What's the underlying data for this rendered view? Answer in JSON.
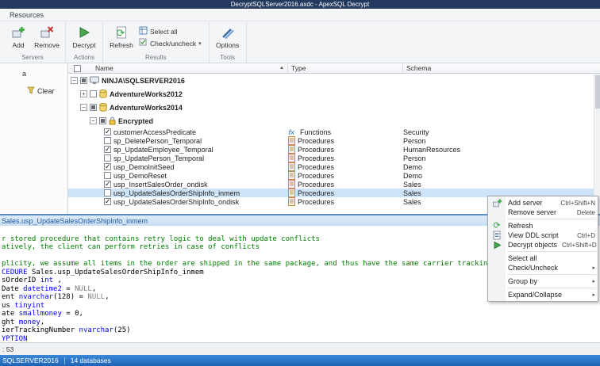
{
  "title_bar": {
    "title": "DecryptSQLServer2016.axdc - ApexSQL Decrypt"
  },
  "colors": {
    "titlebar": "#24395e",
    "statusbar": "#2673c8",
    "selection": "#cde3f7",
    "accent_green": "#3aa83e",
    "comment_green": "#008000",
    "keyword_blue": "#0000ff"
  },
  "ribbon": {
    "tab": "Resources",
    "add": "Add",
    "remove": "Remove",
    "decrypt": "Decrypt",
    "refresh": "Refresh",
    "select_all": "Select all",
    "check_uncheck": "Check/uncheck",
    "options": "Options",
    "group_servers": "Servers",
    "group_actions": "Actions",
    "group_results": "Results",
    "group_tools": "Tools"
  },
  "sidebar": {
    "partial_label": "a",
    "clear_label": "Clear"
  },
  "grid": {
    "columns": {
      "name": "Name",
      "type": "Type",
      "schema": "Schema"
    },
    "sort_indicator": "asc",
    "rows": [
      {
        "level": 0,
        "name": "NINJA\\SQLSERVER2016",
        "expander": "open",
        "check": "partial",
        "bold": true,
        "icon": "server"
      },
      {
        "level": 1,
        "name": "AdventureWorks2012",
        "expander": "closed",
        "check": "off",
        "bold": true,
        "icon": "db"
      },
      {
        "level": 1,
        "name": "AdventureWorks2014",
        "expander": "open",
        "check": "partial",
        "bold": true,
        "icon": "db"
      },
      {
        "level": 2,
        "name": "Encrypted",
        "expander": "open",
        "check": "partial",
        "bold": true,
        "icon": "lock"
      },
      {
        "level": 3,
        "name": "customerAccessPredicate",
        "check": "on",
        "obj_type": "Functions",
        "schema": "Security"
      },
      {
        "level": 3,
        "name": "sp_DeletePerson_Temporal",
        "check": "off",
        "obj_type": "Procedures",
        "schema": "Person"
      },
      {
        "level": 3,
        "name": "sp_UpdateEmployee_Temporal",
        "check": "on",
        "obj_type": "Procedures",
        "schema": "HumanResources"
      },
      {
        "level": 3,
        "name": "sp_UpdatePerson_Temporal",
        "check": "off",
        "obj_type": "Procedures",
        "schema": "Person"
      },
      {
        "level": 3,
        "name": "usp_DemoInitSeed",
        "check": "on",
        "obj_type": "Procedures",
        "schema": "Demo"
      },
      {
        "level": 3,
        "name": "usp_DemoReset",
        "check": "off",
        "obj_type": "Procedures",
        "schema": "Demo"
      },
      {
        "level": 3,
        "name": "usp_InsertSalesOrder_ondisk",
        "check": "on",
        "obj_type": "Procedures",
        "schema": "Sales"
      },
      {
        "level": 3,
        "name": "usp_UpdateSalesOrderShipInfo_inmem",
        "check": "off",
        "obj_type": "Procedures",
        "schema": "Sales",
        "selected": true
      },
      {
        "level": 3,
        "name": "usp_UpdateSalesOrderShipInfo_ondisk",
        "check": "on",
        "obj_type": "Procedures",
        "schema": "Sales"
      }
    ]
  },
  "context_menu": {
    "items": [
      {
        "label": "Add server",
        "shortcut": "Ctrl+Shift+N",
        "icon": "add-server"
      },
      {
        "label": "Remove server",
        "shortcut": "Delete"
      },
      {
        "sep": true
      },
      {
        "label": "Refresh",
        "icon": "refresh"
      },
      {
        "label": "View DDL script",
        "shortcut": "Ctrl+D",
        "icon": "ddl"
      },
      {
        "label": "Decrypt objects",
        "shortcut": "Ctrl+Shift+D",
        "icon": "decrypt"
      },
      {
        "sep": true
      },
      {
        "label": "Select all"
      },
      {
        "label": "Check/Uncheck",
        "submenu": true
      },
      {
        "sep": true
      },
      {
        "label": "Group by",
        "submenu": true
      },
      {
        "sep": true
      },
      {
        "label": "Expand/Collapse",
        "submenu": true
      }
    ]
  },
  "script_panel": {
    "header": "Sales.usp_UpdateSalesOrderShipInfo_inmem",
    "lines": [
      [],
      [
        {
          "c": "c",
          "t": "r stored procedure that contains retry logic to deal with update conflicts"
        }
      ],
      [
        {
          "c": "c",
          "t": "atively, the client can perform retries in case of conflicts"
        }
      ],
      [],
      [
        {
          "c": "c",
          "t": "plicity, we assume all items in the order are shipped in the same package, and thus have the same carrier tracking number"
        }
      ],
      [
        {
          "c": "k",
          "t": "CEDURE "
        },
        {
          "c": "p",
          "t": "Sales.usp_UpdateSalesOrderShipInfo_inmem"
        }
      ],
      [
        {
          "c": "p",
          "t": "sOrderID "
        },
        {
          "c": "k",
          "t": "int"
        },
        {
          "c": "p",
          "t": " ,"
        }
      ],
      [
        {
          "c": "p",
          "t": "Date "
        },
        {
          "c": "k",
          "t": "datetime2"
        },
        {
          "c": "p",
          "t": " = "
        },
        {
          "c": "g",
          "t": "NULL"
        },
        {
          "c": "p",
          "t": ","
        }
      ],
      [
        {
          "c": "p",
          "t": "ent "
        },
        {
          "c": "k",
          "t": "nvarchar"
        },
        {
          "c": "p",
          "t": "(128) = "
        },
        {
          "c": "g",
          "t": "NULL"
        },
        {
          "c": "p",
          "t": ","
        }
      ],
      [
        {
          "c": "p",
          "t": "us "
        },
        {
          "c": "k",
          "t": "tinyint"
        }
      ],
      [
        {
          "c": "p",
          "t": "ate "
        },
        {
          "c": "k",
          "t": "smallmoney"
        },
        {
          "c": "p",
          "t": " = 0,"
        }
      ],
      [
        {
          "c": "p",
          "t": "ght "
        },
        {
          "c": "k",
          "t": "money"
        },
        {
          "c": "p",
          "t": ","
        }
      ],
      [
        {
          "c": "p",
          "t": "ierTrackingNumber "
        },
        {
          "c": "k",
          "t": "nvarchar"
        },
        {
          "c": "p",
          "t": "(25)"
        }
      ],
      [
        {
          "c": "k",
          "t": "YPTION"
        }
      ]
    ]
  },
  "editor_status": {
    "text": ": 53"
  },
  "status_bar": {
    "server": "SQLSERVER2016",
    "databases": "14 databases"
  }
}
